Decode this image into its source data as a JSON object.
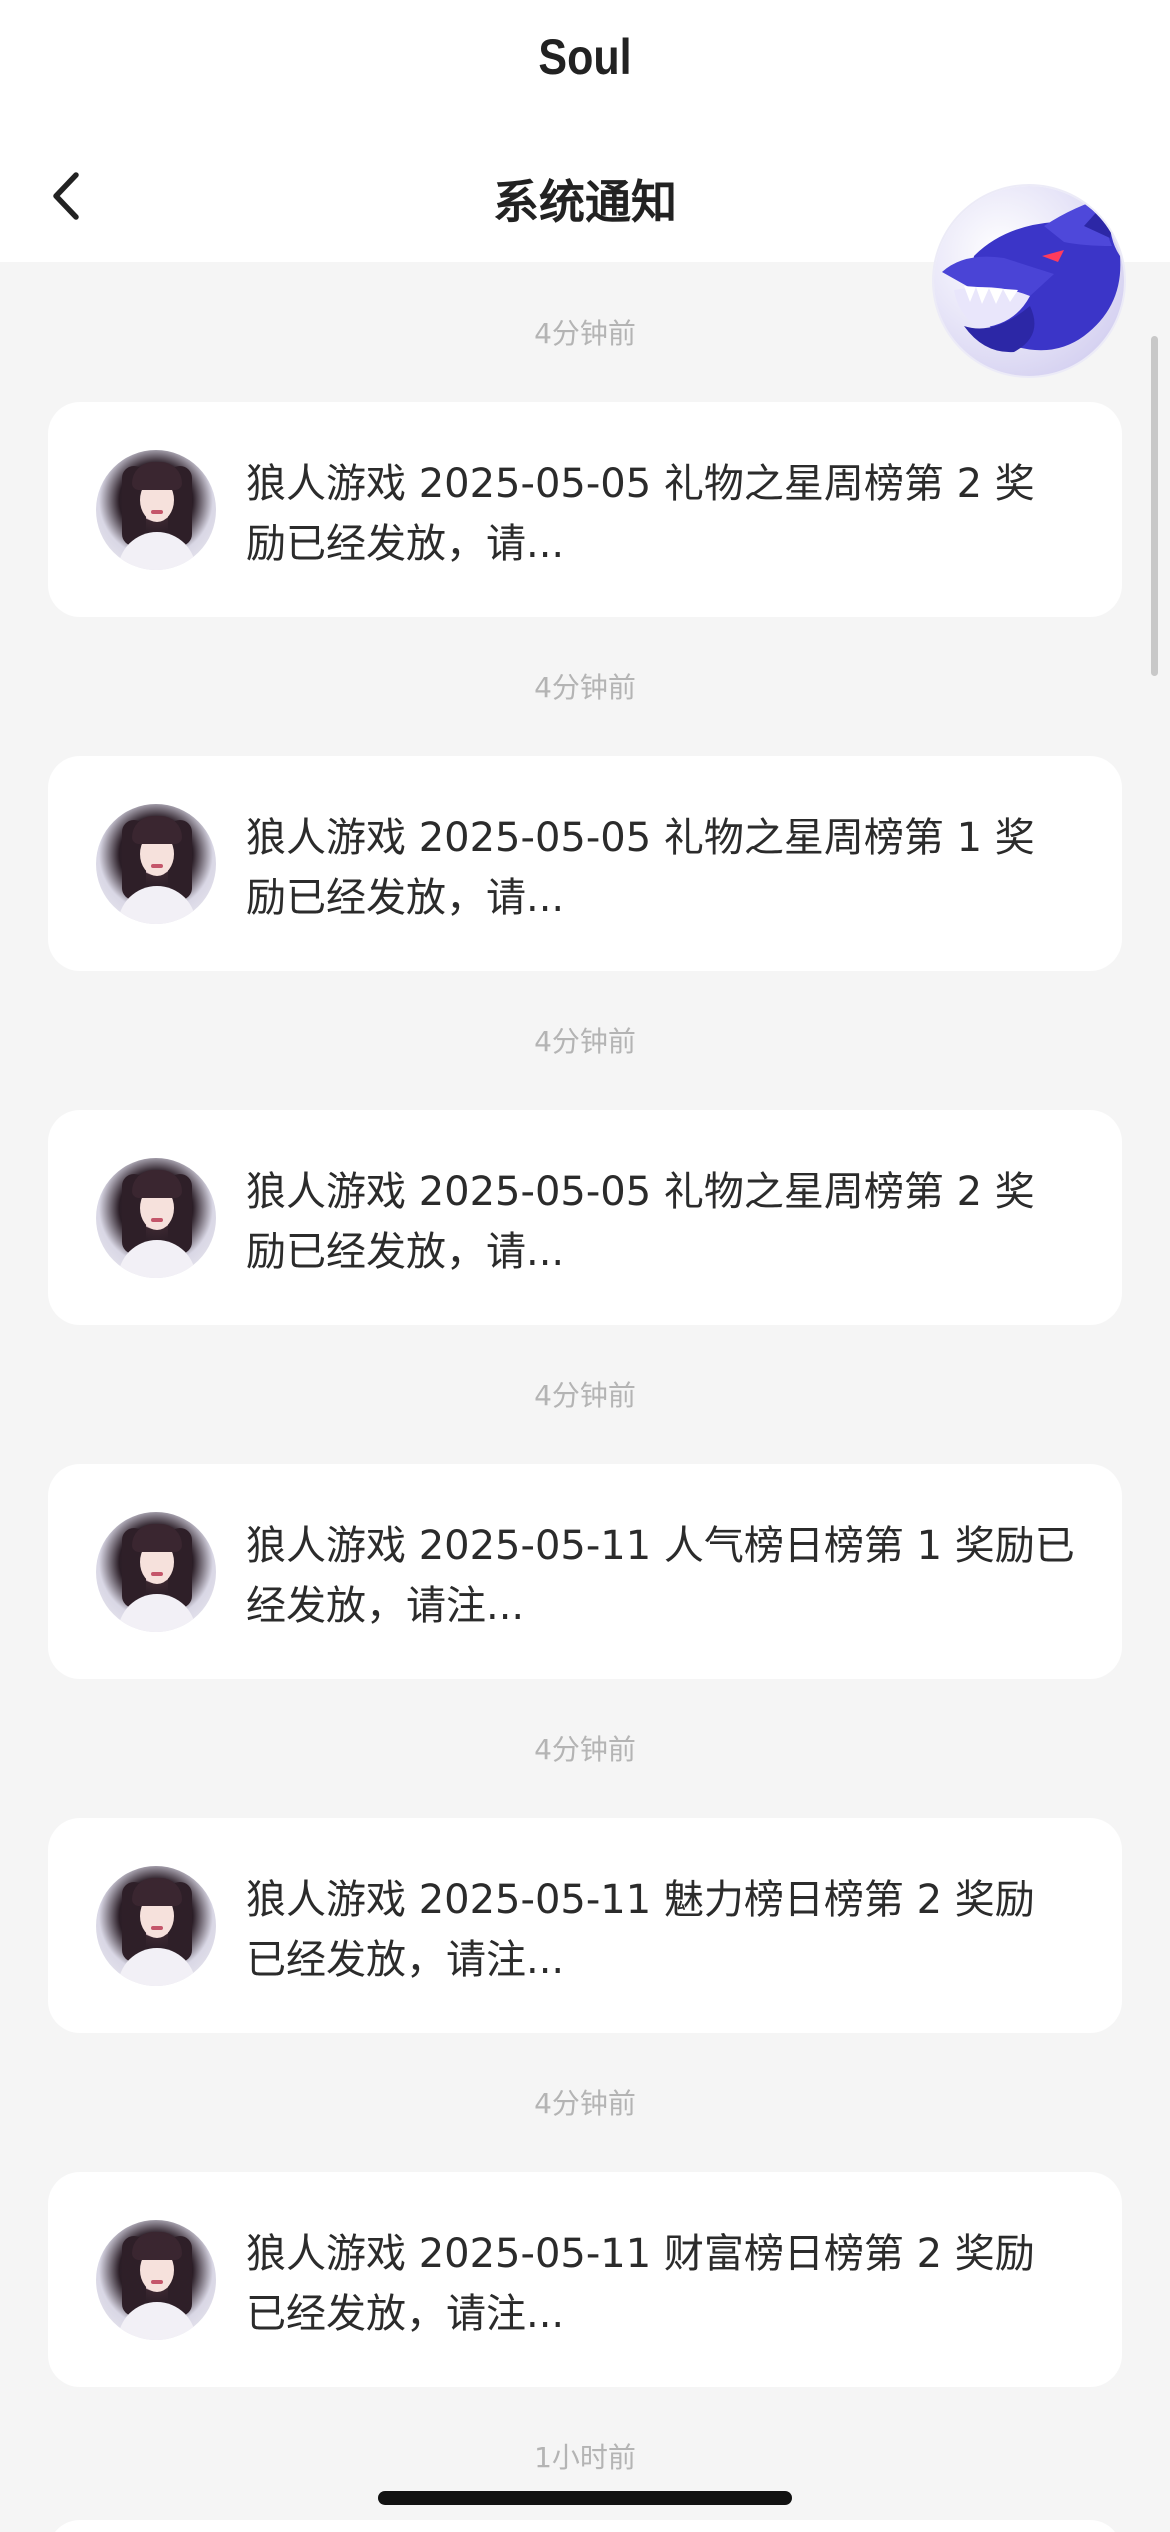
{
  "app": {
    "brand": "Soul"
  },
  "header": {
    "title": "系统通知",
    "back_icon": "chevron-left-icon"
  },
  "colors": {
    "background": "#f5f5f5",
    "card": "#ffffff",
    "text": "#2b2b2b",
    "timestamp": "#b4b4b4",
    "mascot": "#3b35c8"
  },
  "notifications": [
    {
      "time": "4分钟前",
      "line1": "狼人游戏 2025-05-05 礼物之星周榜第 2 奖",
      "line2": "励已经发放，请..."
    },
    {
      "time": "4分钟前",
      "line1": "狼人游戏 2025-05-05 礼物之星周榜第 1 奖",
      "line2": "励已经发放，请..."
    },
    {
      "time": "4分钟前",
      "line1": "狼人游戏 2025-05-05 礼物之星周榜第 2 奖",
      "line2": "励已经发放，请..."
    },
    {
      "time": "4分钟前",
      "line1": "狼人游戏 2025-05-11 人气榜日榜第 1 奖励已",
      "line2": "经发放，请注..."
    },
    {
      "time": "4分钟前",
      "line1": "狼人游戏 2025-05-11 魅力榜日榜第 2 奖励",
      "line2": "已经发放，请注..."
    },
    {
      "time": "4分钟前",
      "line1": "狼人游戏 2025-05-11 财富榜日榜第 2 奖励",
      "line2": "已经发放，请注..."
    }
  ],
  "last_time": "1小时前"
}
